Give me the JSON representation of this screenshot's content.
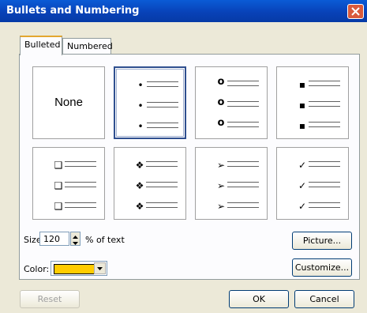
{
  "window": {
    "title": "Bullets and Numbering"
  },
  "tabs": [
    {
      "label": "Bulleted"
    },
    {
      "label": "Numbered"
    }
  ],
  "gallery": {
    "none_label": "None",
    "options": [
      {
        "name": "none",
        "glyph": ""
      },
      {
        "name": "filled-dot",
        "glyph": "•"
      },
      {
        "name": "hollow-circle",
        "glyph": "o"
      },
      {
        "name": "filled-square",
        "glyph": "▪"
      },
      {
        "name": "hollow-square",
        "glyph": "❑"
      },
      {
        "name": "four-diamond",
        "glyph": "❖"
      },
      {
        "name": "arrowhead",
        "glyph": "➢"
      },
      {
        "name": "checkmark",
        "glyph": "✓"
      }
    ],
    "selected_index": 1
  },
  "size": {
    "label": "Size:",
    "value": "120",
    "suffix": "% of text"
  },
  "color": {
    "label": "Color:",
    "value": "#ffcc00"
  },
  "buttons": {
    "picture": "Picture...",
    "customize": "Customize...",
    "reset": "Reset",
    "ok": "OK",
    "cancel": "Cancel"
  }
}
